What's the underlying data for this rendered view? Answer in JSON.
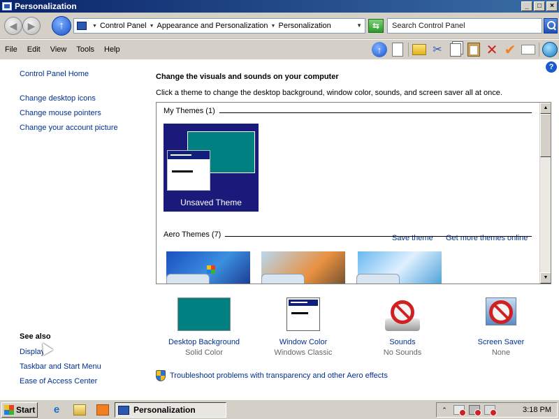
{
  "window": {
    "title": "Personalization",
    "controls": [
      "_",
      "□",
      "×"
    ]
  },
  "address": {
    "crumbs": [
      "Control Panel",
      "Appearance and Personalization",
      "Personalization"
    ],
    "search_placeholder": "Search Control Panel"
  },
  "menu": {
    "items": [
      "File",
      "Edit",
      "View",
      "Tools",
      "Help"
    ]
  },
  "toolbar": {
    "icons": [
      "up-icon",
      "page-icon",
      "folder-icon",
      "scissors-icon",
      "copy-icon",
      "paste-icon",
      "delete-icon",
      "check-icon",
      "mail-icon",
      "globe-icon"
    ]
  },
  "sidebar": {
    "home": "Control Panel Home",
    "links": [
      "Change desktop icons",
      "Change mouse pointers",
      "Change your account picture"
    ],
    "see_also_title": "See also",
    "see_also": [
      "Display",
      "Taskbar and Start Menu",
      "Ease of Access Center"
    ]
  },
  "main": {
    "heading": "Change the visuals and sounds on your computer",
    "subheading": "Click a theme to change the desktop background, window color, sounds, and screen saver all at once.",
    "my_themes_label": "My Themes (1)",
    "unsaved_theme": "Unsaved Theme",
    "save_theme": "Save theme",
    "get_more_themes": "Get more themes online",
    "aero_themes_label": "Aero Themes (7)"
  },
  "settings": [
    {
      "name": "Desktop Background",
      "value": "Solid Color"
    },
    {
      "name": "Window Color",
      "value": "Windows Classic"
    },
    {
      "name": "Sounds",
      "value": "No Sounds"
    },
    {
      "name": "Screen Saver",
      "value": "None"
    }
  ],
  "troubleshoot": "Troubleshoot problems with transparency and other Aero effects",
  "taskbar": {
    "start": "Start",
    "task": "Personalization",
    "clock": "3:18 PM"
  },
  "colors": {
    "title_bar": "#0a246a",
    "link": "#00308f",
    "theme_tile": "#1a1a7a",
    "teal": "#008080"
  }
}
